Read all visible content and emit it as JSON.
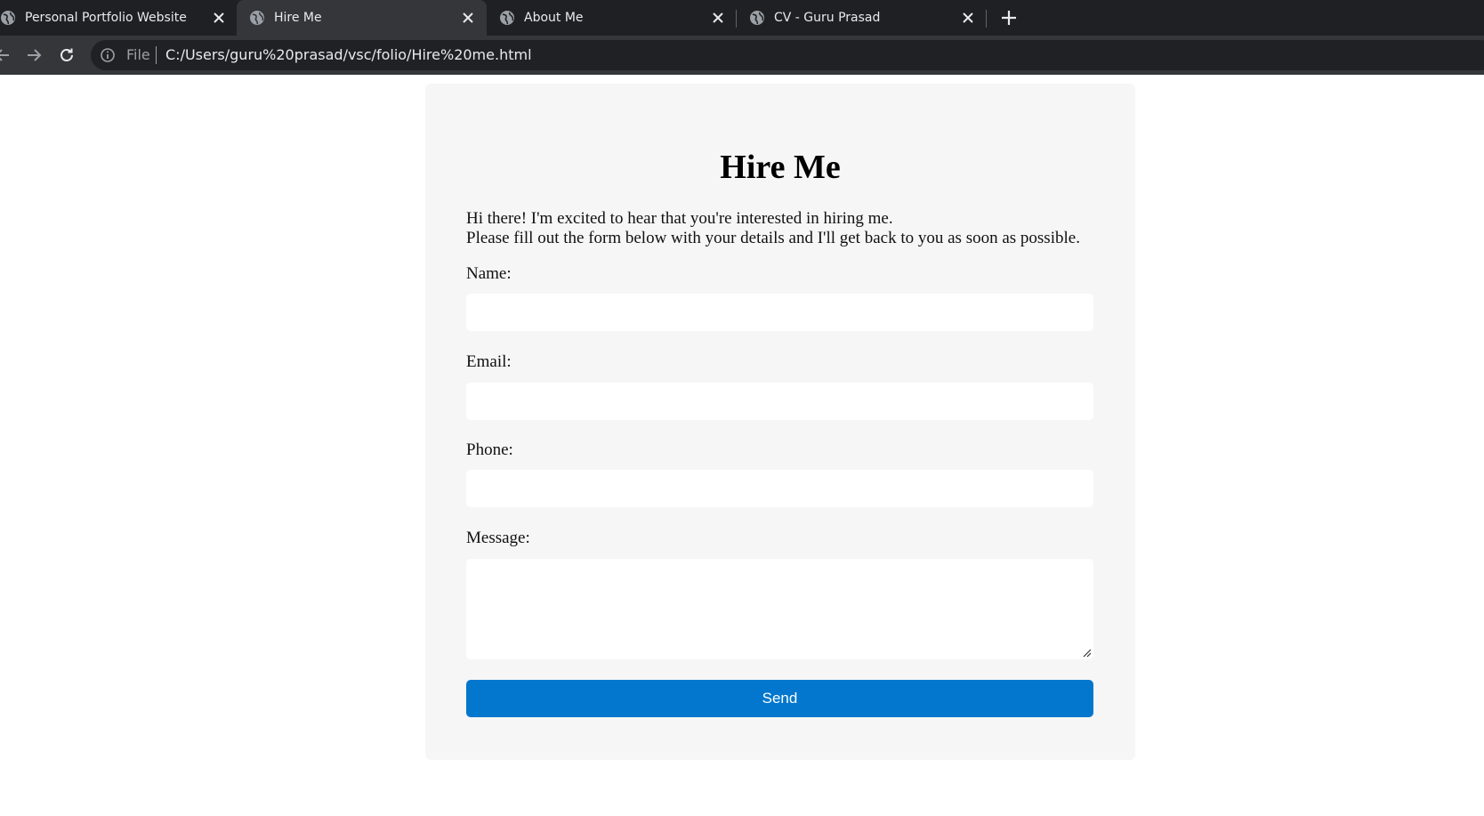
{
  "browser": {
    "tabs": [
      {
        "title": "Personal Portfolio Website",
        "active": false
      },
      {
        "title": "Hire Me",
        "active": true
      },
      {
        "title": "About Me",
        "active": false
      },
      {
        "title": "CV - Guru Prasad",
        "active": false
      }
    ],
    "address_bar": {
      "scheme_label": "File",
      "url": "C:/Users/guru%20prasad/vsc/folio/Hire%20me.html"
    },
    "icons": {
      "favicon": "globe-icon",
      "close": "close-icon",
      "new_tab": "plus-icon",
      "back": "back-arrow-icon",
      "forward": "forward-arrow-icon",
      "reload": "reload-icon",
      "info": "info-icon"
    }
  },
  "page": {
    "heading": "Hire Me",
    "intro": {
      "line1": "Hi there! I'm excited to hear that you're interested in hiring me.",
      "line2": "Please fill out the form below with your details and I'll get back to you as soon as possible."
    },
    "form": {
      "name_label": "Name:",
      "name_value": "",
      "email_label": "Email:",
      "email_value": "",
      "phone_label": "Phone:",
      "phone_value": "",
      "message_label": "Message:",
      "message_value": "",
      "send_label": "Send"
    },
    "colors": {
      "card_background": "#f6f6f6",
      "button_background": "#0277cd",
      "chrome_dark": "#1f2023"
    }
  }
}
